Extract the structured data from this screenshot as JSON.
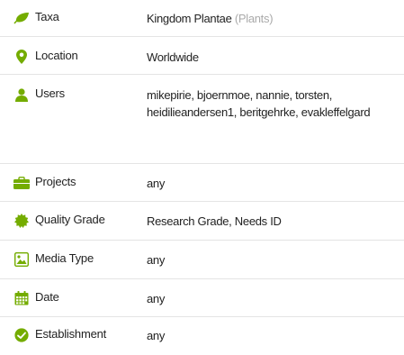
{
  "filters": {
    "taxa": {
      "label": "Taxa",
      "value": "Kingdom Plantae",
      "value_note": "(Plants)"
    },
    "location": {
      "label": "Location",
      "value": "Worldwide"
    },
    "users": {
      "label": "Users",
      "value": "mikepirie, bjoernmoe, nannie, torsten, heidilieandersen1, beritgehrke, evakleffelgard"
    },
    "projects": {
      "label": "Projects",
      "value": "any"
    },
    "quality_grade": {
      "label": "Quality Grade",
      "value": "Research Grade, Needs ID"
    },
    "media_type": {
      "label": "Media Type",
      "value": "any"
    },
    "date": {
      "label": "Date",
      "value": "any"
    },
    "establishment": {
      "label": "Establishment",
      "value": "any"
    }
  },
  "icons": {
    "taxa": "leaf-icon",
    "location": "map-marker-icon",
    "users": "user-icon",
    "projects": "briefcase-icon",
    "quality_grade": "certificate-icon",
    "media_type": "image-icon",
    "date": "calendar-icon",
    "establishment": "establishment-icon"
  },
  "colors": {
    "icon_green": "#74ac00",
    "text": "#222222",
    "muted": "#aaaaaa",
    "divider": "#e4e4e4"
  }
}
